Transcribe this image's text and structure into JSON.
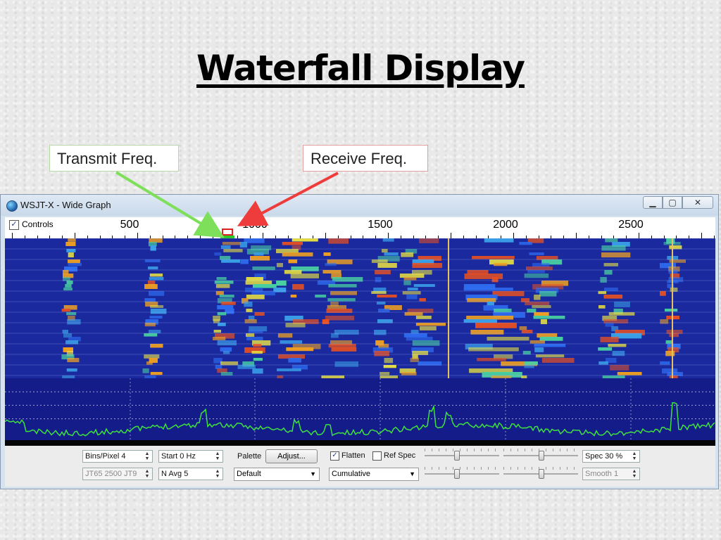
{
  "slide": {
    "title": "Waterfall Display",
    "callout_transmit": "Transmit Freq.",
    "callout_receive": "Receive Freq.",
    "arrow_transmit_color": "#7ee05a",
    "arrow_receive_color": "#ee3b3b"
  },
  "window": {
    "title": "WSJT-X - Wide Graph",
    "min_label": "▁",
    "max_label": "▢",
    "close_label": "✕"
  },
  "scale": {
    "controls_label": "Controls",
    "controls_checked": true,
    "freq_labels": [
      "500",
      "1000",
      "1500",
      "2000",
      "2500"
    ]
  },
  "controls": {
    "bins_pixel": "Bins/Pixel  4",
    "start": "Start 0 Hz",
    "mode": "JT65  2500  JT9",
    "navg": "N Avg 5",
    "palette_label": "Palette",
    "adjust_button": "Adjust...",
    "palette_value": "Default",
    "flatten_label": "Flatten",
    "flatten_checked": true,
    "ref_spec_label": "Ref Spec",
    "ref_spec_checked": false,
    "spectrum_mode": "Cumulative",
    "spec": "Spec 30 %",
    "smooth": "Smooth  1"
  },
  "colors": {
    "waterfall_bg": "#1a2a9e",
    "spectrum_line": "#3ee03e",
    "receive_marker": "#e02020",
    "transmit_marker": "#28c828"
  }
}
